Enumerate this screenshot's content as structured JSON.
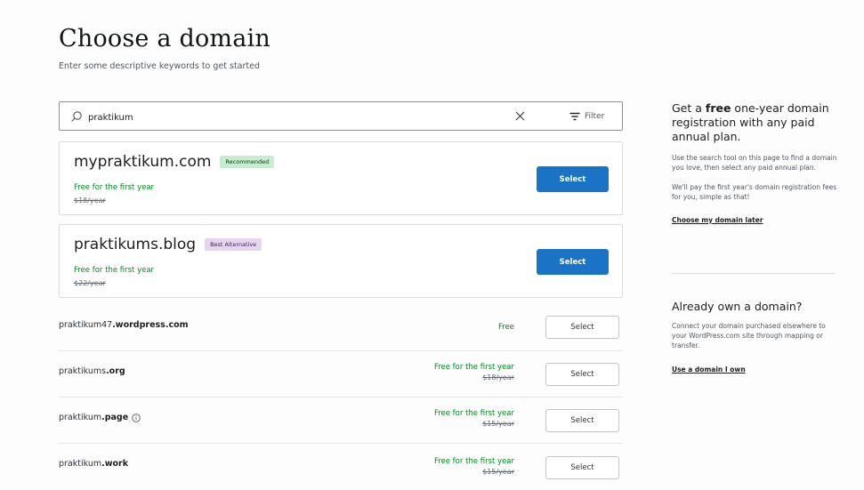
{
  "header": {
    "title": "Choose a domain",
    "subtitle": "Enter some descriptive keywords to get started"
  },
  "search": {
    "value": "praktikum",
    "filter_label": "Filter",
    "icons": {
      "search": "search-icon",
      "clear": "close-icon",
      "filter": "filter-icon"
    }
  },
  "featured": [
    {
      "domain": "mypraktikum.com",
      "badge": "Recommended",
      "free_text": "Free for the first year",
      "original_price": "$18/year",
      "button_label": "Select"
    },
    {
      "domain": "praktikums.blog",
      "badge": "Best Alternative",
      "free_text": "Free for the first year",
      "original_price": "$22/year",
      "button_label": "Select"
    }
  ],
  "results": [
    {
      "name": "praktikum47",
      "tld": ".wordpress.com",
      "price_text": "Free",
      "original_price": "",
      "info": false,
      "button_label": "Select"
    },
    {
      "name": "praktikums",
      "tld": ".org",
      "price_text": "Free for the first year",
      "original_price": "$18/year",
      "info": false,
      "button_label": "Select"
    },
    {
      "name": "praktikum",
      "tld": ".page",
      "price_text": "Free for the first year",
      "original_price": "$15/year",
      "info": true,
      "button_label": "Select"
    },
    {
      "name": "praktikum",
      "tld": ".work",
      "price_text": "Free for the first year",
      "original_price": "$15/year",
      "info": false,
      "button_label": "Select"
    }
  ],
  "sidebar": {
    "promo": {
      "heading_pre": "Get a ",
      "heading_bold": "free",
      "heading_post": " one-year domain registration with any paid annual plan.",
      "text1": "Use the search tool on this page to find a domain you love, then select any paid annual plan.",
      "text2": "We'll pay the first year's domain registration fees for you, simple as that!",
      "link": "Choose my domain later"
    },
    "own": {
      "heading": "Already own a domain?",
      "text": "Connect your domain purchased elsewhere to your WordPress.com site through mapping or transfer.",
      "link": "Use a domain I own"
    }
  },
  "colors": {
    "primary": "#1a73c4",
    "success": "#008a20",
    "recommended_badge": "#c7ecd0",
    "alternative_badge": "#e6d5ee"
  }
}
